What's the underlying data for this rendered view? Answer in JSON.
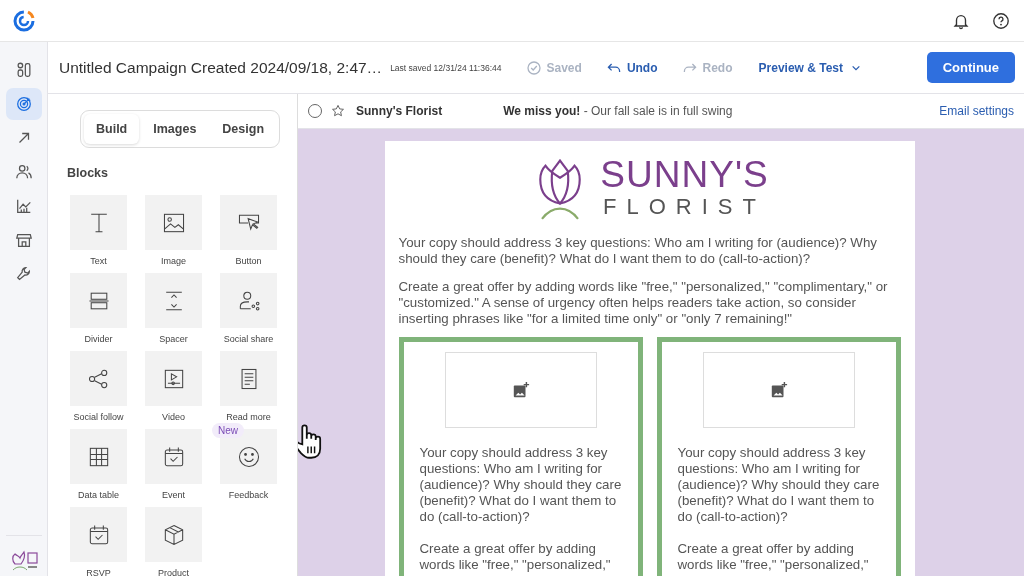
{
  "nav": [
    {
      "kind": "dashboard",
      "selected": false
    },
    {
      "kind": "campaigns",
      "selected": true
    },
    {
      "kind": "send",
      "selected": false
    },
    {
      "kind": "contacts",
      "selected": false
    },
    {
      "kind": "reports",
      "selected": false
    },
    {
      "kind": "store",
      "selected": false
    },
    {
      "kind": "tools",
      "selected": false
    }
  ],
  "header": {
    "title": "Untitled Campaign Created 2024/09/18, 2:47…",
    "last_saved": "Last saved 12/31/24 11:36:44",
    "actions": [
      {
        "kind": "saved",
        "label": "Saved",
        "disabled": true
      },
      {
        "kind": "undo",
        "label": "Undo",
        "disabled": false
      },
      {
        "kind": "redo",
        "label": "Redo",
        "disabled": true
      }
    ],
    "preview": "Preview & Test",
    "continue": "Continue"
  },
  "panel": {
    "tabs": [
      {
        "label": "Build",
        "selected": true
      },
      {
        "label": "Images",
        "selected": false
      },
      {
        "label": "Design",
        "selected": false
      }
    ],
    "section": "Blocks",
    "blocks": [
      {
        "label": "Text",
        "kind": "text"
      },
      {
        "label": "Image",
        "kind": "image"
      },
      {
        "label": "Button",
        "kind": "button"
      },
      {
        "label": "Divider",
        "kind": "divider"
      },
      {
        "label": "Spacer",
        "kind": "spacer"
      },
      {
        "label": "Social share",
        "kind": "share"
      },
      {
        "label": "Social follow",
        "kind": "follow"
      },
      {
        "label": "Video",
        "kind": "video"
      },
      {
        "label": "Read more",
        "kind": "readmore"
      },
      {
        "label": "Data table",
        "kind": "table"
      },
      {
        "label": "Event",
        "kind": "event"
      },
      {
        "label": "Feedback",
        "kind": "feedback",
        "badge": "New"
      },
      {
        "label": "RSVP",
        "kind": "event"
      },
      {
        "label": "Product",
        "kind": "product"
      }
    ]
  },
  "email": {
    "checked": false,
    "sender": "Sunny's Florist",
    "subject": "**We miss you!** - Our fall sale is in full swing",
    "settings": "Email settings",
    "logo": {
      "name": "SUNNY'S",
      "sub": "FLORIST"
    },
    "paragraphs": [
      "Your copy should address 3 key questions: Who am I writing for (audience)? Why should they care (benefit)? What do I want them to do (call-to-action)?",
      "Create a great offer by adding words like \"free,\" \"personalized,\" \"complimentary,\" or \"customized.\" A sense of urgency often helps readers take action, so consider inserting phrases like \"for a limited time only\" or \"only 7 remaining!\""
    ],
    "cards": [
      {
        "paragraphs": [
          "Your copy should address 3 key questions: Who am I writing for (audience)? Why should they care (benefit)? What do I want them to do (call-to-action)?",
          "Create a great offer by adding words like \"free,\" \"personalized,\""
        ]
      },
      {
        "paragraphs": [
          "Your copy should address 3 key questions: Who am I writing for (audience)? Why should they care (benefit)? What do I want them to do (call-to-action)?",
          "Create a great offer by adding words like \"free,\" \"personalized,\""
        ]
      }
    ]
  }
}
